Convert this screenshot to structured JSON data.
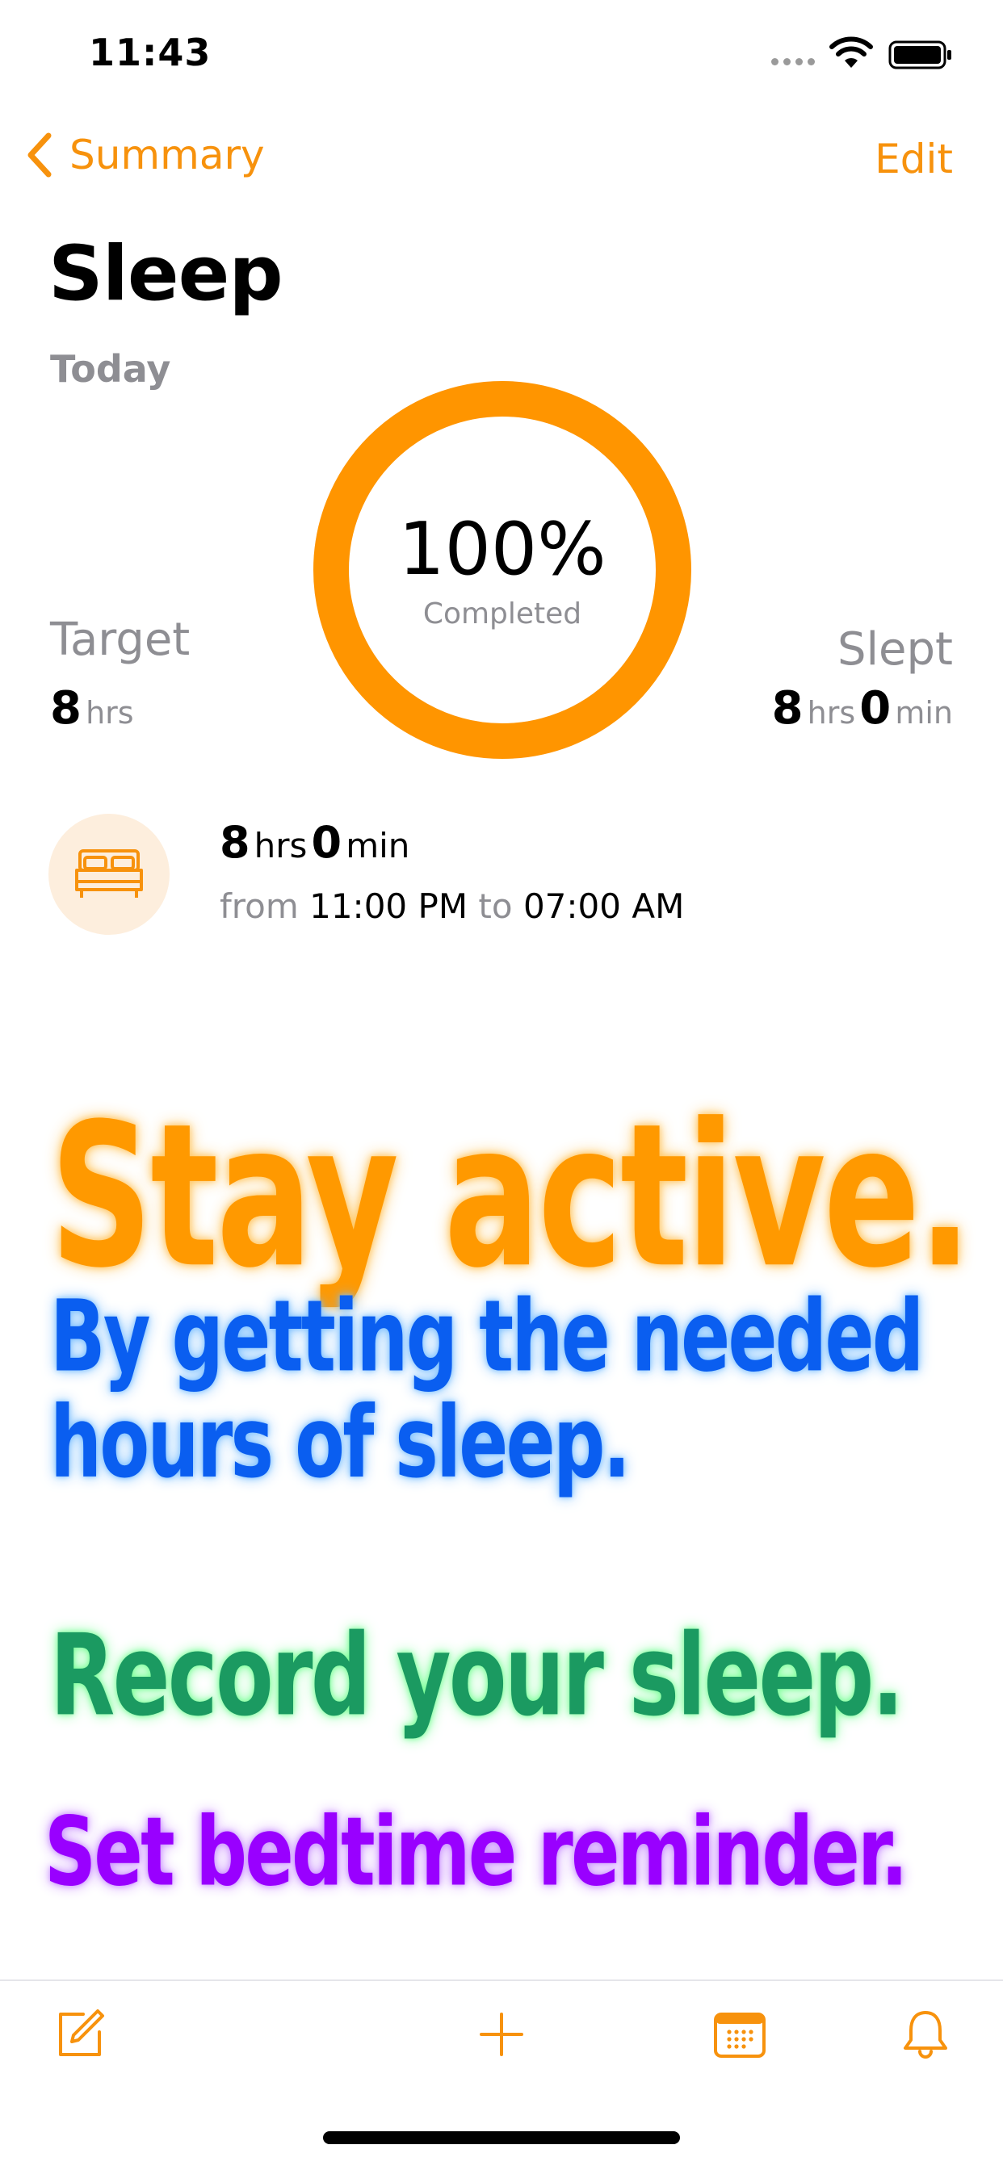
{
  "status_bar": {
    "time": "11:43"
  },
  "nav": {
    "back_label": "Summary",
    "edit_label": "Edit"
  },
  "header": {
    "title": "Sleep",
    "period": "Today"
  },
  "progress": {
    "percent_label": "100%",
    "subtitle": "Completed",
    "fraction": 1.0
  },
  "target": {
    "label": "Target",
    "value": "8",
    "unit": "hrs"
  },
  "slept": {
    "label": "Slept",
    "hours": "8",
    "hours_unit": "hrs",
    "minutes": "0",
    "minutes_unit": "min"
  },
  "entry": {
    "hours": "8",
    "hours_unit": "hrs",
    "minutes": "0",
    "minutes_unit": "min",
    "from_word": "from",
    "start": "11:00 PM",
    "to_word": "to",
    "end": "07:00 AM"
  },
  "promo": {
    "headline": "Stay active.",
    "line1": "By getting the needed",
    "line2": "hours of sleep.",
    "record": "Record your sleep.",
    "reminder": "Set bedtime reminder."
  },
  "toolbar": {
    "icons": [
      "compose-icon",
      "plus-icon",
      "calendar-icon",
      "bell-icon"
    ]
  },
  "colors": {
    "accent": "#f7920d",
    "ring": "#ff9500",
    "headline": "#ff9900",
    "blue": "#0a5ef0",
    "green": "#1b9a61",
    "purple": "#9900ff"
  }
}
